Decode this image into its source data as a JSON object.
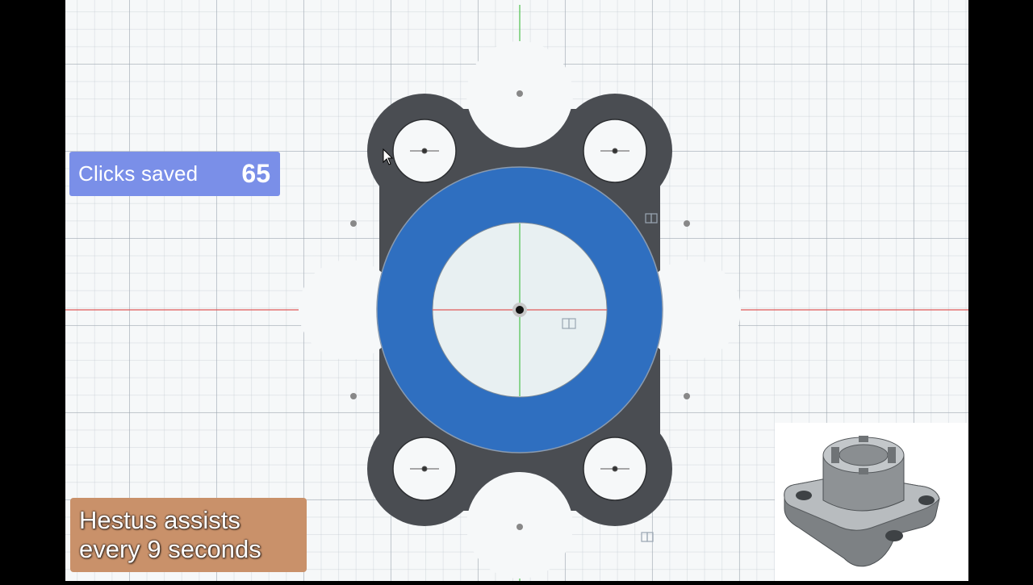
{
  "overlay": {
    "clicks_saved_label": "Clicks saved",
    "clicks_saved_value": "65",
    "caption_line1": "Hestus assists",
    "caption_line2": "every 9 seconds"
  },
  "colors": {
    "part_body": "#4a4d52",
    "selected_profile": "#2f6fc0",
    "x_axis": "#e05a5a",
    "y_axis": "#4cc14c",
    "canvas_bg": "#f6f8f9"
  },
  "viewport": {
    "icons": [
      "cursor-arrow-icon",
      "constraint-icon",
      "origin-point-icon"
    ]
  }
}
